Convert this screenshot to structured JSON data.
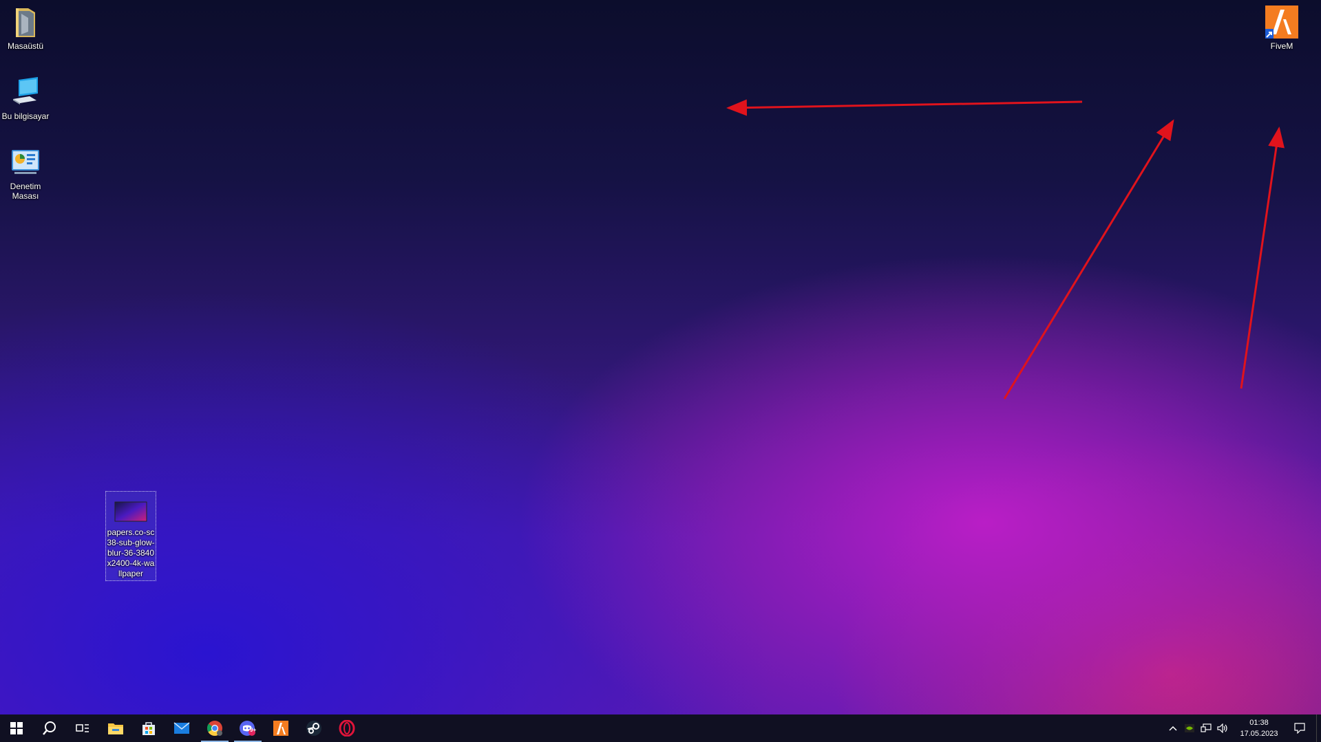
{
  "desktop": {
    "icons": [
      {
        "label": "Masaüstü"
      },
      {
        "label": "Bu bilgisayar"
      },
      {
        "label": "Denetim Masası"
      },
      {
        "label": "papers.co-sc38-sub-glow-blur-36-3840x2400-4k-wallpaper"
      },
      {
        "label": "FiveM"
      }
    ],
    "annotation_color": "#e0131c"
  },
  "taskbar": {
    "apps": [
      "start",
      "search",
      "task-view",
      "file-explorer",
      "microsoft-store",
      "mail",
      "chrome",
      "discord",
      "fivem",
      "steam",
      "opera"
    ],
    "discord_badge": "9+",
    "tray": {
      "time": "01:38",
      "date": "17.05.2023"
    },
    "accent": "#8fb8e8"
  }
}
